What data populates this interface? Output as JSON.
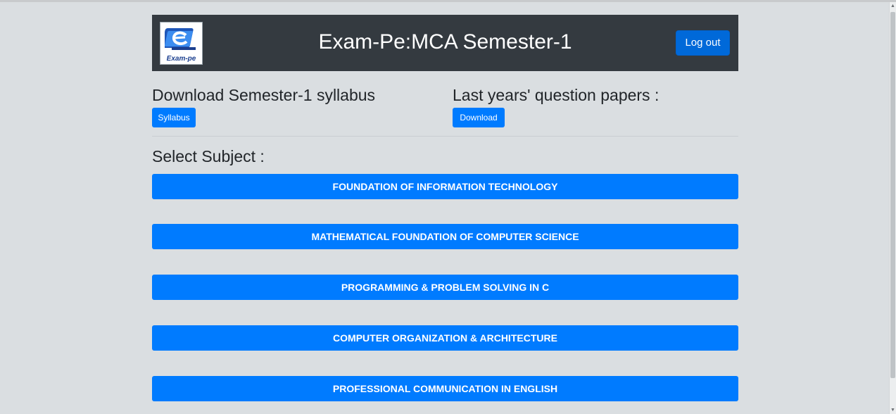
{
  "header": {
    "logo_text": "Exam-pe",
    "title": "Exam-Pe:MCA Semester-1",
    "logout_label": "Log out"
  },
  "downloads": {
    "syllabus_heading": "Download Semester-1 syllabus",
    "syllabus_button": "Syllabus",
    "papers_heading": "Last years' question papers :",
    "papers_button": "Download"
  },
  "subjects": {
    "heading": "Select Subject :",
    "items": [
      "FOUNDATION OF INFORMATION TECHNOLOGY",
      "MATHEMATICAL FOUNDATION OF COMPUTER SCIENCE",
      "PROGRAMMING & PROBLEM SOLVING IN C",
      "COMPUTER ORGANIZATION & ARCHITECTURE",
      "PROFESSIONAL COMMUNICATION IN ENGLISH"
    ]
  },
  "colors": {
    "background": "#dadee1",
    "header_bg": "#343a40",
    "primary": "#007bff",
    "logout": "#0069d9"
  }
}
